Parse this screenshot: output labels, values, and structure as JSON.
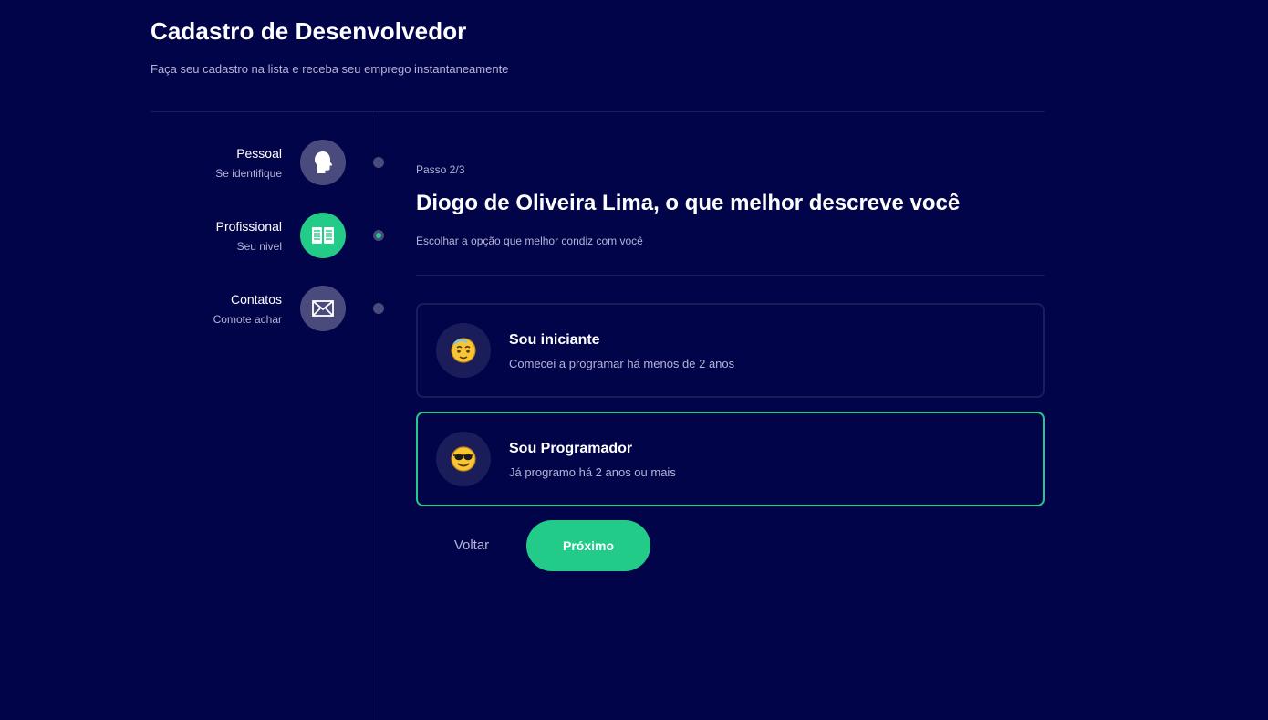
{
  "header": {
    "title": "Cadastro de Desenvolvedor",
    "subtitle": "Faça seu cadastro na lista e receba seu emprego instantaneamente"
  },
  "steps": [
    {
      "title": "Pessoal",
      "subtitle": "Se identifique",
      "icon": "person-head-icon",
      "active": false
    },
    {
      "title": "Profissional",
      "subtitle": "Seu nivel",
      "icon": "book-icon",
      "active": true
    },
    {
      "title": "Contatos",
      "subtitle": "Comote achar",
      "icon": "mail-icon",
      "active": false
    }
  ],
  "form": {
    "step_counter": "Passo 2/3",
    "question": "Diogo de Oliveira Lima, o que melhor descreve você",
    "hint": "Escolhar a opção que melhor condiz com você",
    "options": [
      {
        "title": "Sou iniciante",
        "description": "Comecei a programar há menos de 2 anos",
        "icon": "dizzy-face-emoji-icon",
        "selected": false
      },
      {
        "title": "Sou Programador",
        "description": "Já programo há 2 anos ou mais",
        "icon": "sunglasses-face-emoji-icon",
        "selected": true
      }
    ],
    "back_label": "Voltar",
    "next_label": "Próximo"
  },
  "colors": {
    "background": "#02044A",
    "accent": "#22CC88",
    "muted_circle": "#4A4B7C",
    "border": "#1B1D5B",
    "secondary_text": "#B4B3D6"
  }
}
